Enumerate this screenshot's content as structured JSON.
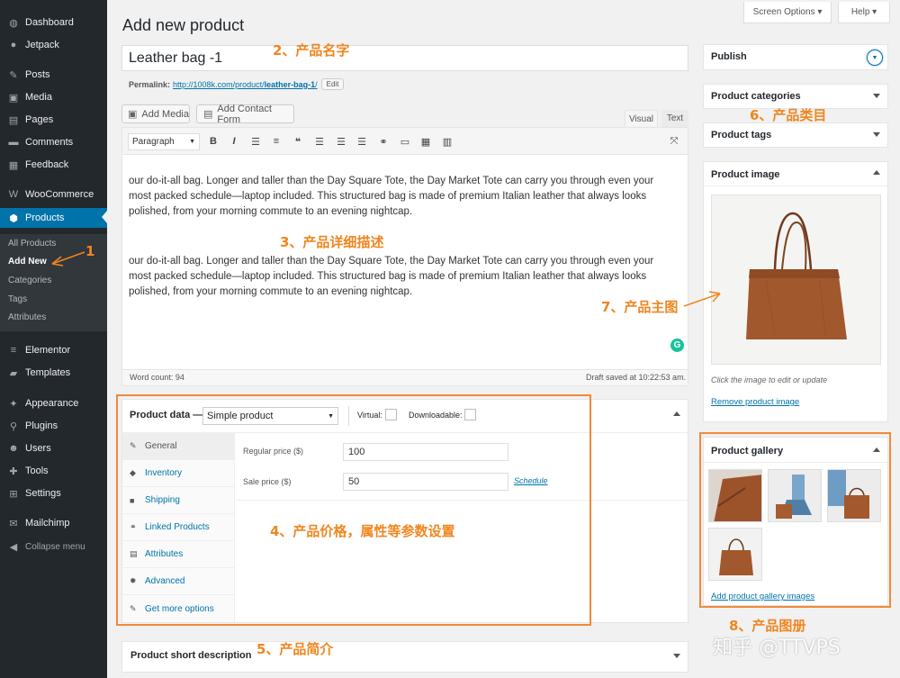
{
  "sidebar": {
    "items": [
      {
        "label": "Dashboard",
        "icon": "dashboard-icon",
        "glyph": "◍"
      },
      {
        "label": "Jetpack",
        "icon": "jetpack-icon",
        "glyph": "●"
      },
      {
        "label": "Posts",
        "icon": "pushpin-icon",
        "glyph": "✎"
      },
      {
        "label": "Media",
        "icon": "media-icon",
        "glyph": "▣"
      },
      {
        "label": "Pages",
        "icon": "pages-icon",
        "glyph": "▤"
      },
      {
        "label": "Comments",
        "icon": "comment-icon",
        "glyph": "▬"
      },
      {
        "label": "Feedback",
        "icon": "feedback-icon",
        "glyph": "▦"
      },
      {
        "label": "WooCommerce",
        "icon": "woocommerce-icon",
        "glyph": "W"
      },
      {
        "label": "Products",
        "icon": "products-icon",
        "glyph": "⬢"
      },
      {
        "label": "Elementor",
        "icon": "elementor-icon",
        "glyph": "≡"
      },
      {
        "label": "Templates",
        "icon": "folder-icon",
        "glyph": "▰"
      },
      {
        "label": "Appearance",
        "icon": "appearance-icon",
        "glyph": "✦"
      },
      {
        "label": "Plugins",
        "icon": "plugin-icon",
        "glyph": "⚲"
      },
      {
        "label": "Users",
        "icon": "users-icon",
        "glyph": "☻"
      },
      {
        "label": "Tools",
        "icon": "tools-icon",
        "glyph": "✚"
      },
      {
        "label": "Settings",
        "icon": "settings-icon",
        "glyph": "⊞"
      },
      {
        "label": "Mailchimp",
        "icon": "mailchimp-icon",
        "glyph": "✉"
      },
      {
        "label": "Collapse menu",
        "icon": "collapse-icon",
        "glyph": "◀"
      }
    ],
    "submenu": [
      "All Products",
      "Add New",
      "Categories",
      "Tags",
      "Attributes"
    ]
  },
  "top": {
    "screen_options": "Screen Options ▾",
    "help": "Help ▾"
  },
  "page_title": "Add new product",
  "title_value": "Leather bag -1",
  "permalink": {
    "label": "Permalink:",
    "url_prefix": "http://1008k.com/product/",
    "url_slug": "leather-bag-1",
    "url_suffix": "/",
    "edit": "Edit"
  },
  "editor": {
    "add_media": "Add Media",
    "add_contact_form": "Add Contact Form",
    "tab_visual": "Visual",
    "tab_text": "Text",
    "format": "Paragraph",
    "paragraph1": "our do-it-all bag. Longer and taller than the Day Square Tote, the Day Market Tote can carry you through even your most packed schedule—laptop included. This structured bag is made of premium Italian leather that always looks polished, from your morning commute to an evening nightcap.",
    "paragraph2": "our do-it-all bag. Longer and taller than the Day Square Tote, the Day Market Tote can carry you through even your most packed schedule—laptop included. This structured bag is made of premium Italian leather that always looks polished, from your morning commute to an evening nightcap.",
    "word_count": "Word count: 94",
    "draft_saved": "Draft saved at 10:22:53 am."
  },
  "product_data": {
    "label": "Product data —",
    "type": "Simple product",
    "virtual": "Virtual:",
    "downloadable": "Downloadable:",
    "tabs": [
      "General",
      "Inventory",
      "Shipping",
      "Linked Products",
      "Attributes",
      "Advanced",
      "Get more options"
    ],
    "regular_price_label": "Regular price ($)",
    "regular_price": "100",
    "sale_price_label": "Sale price ($)",
    "sale_price": "50",
    "schedule": "Schedule"
  },
  "short_description": "Product short description",
  "right": {
    "publish": "Publish",
    "categories": "Product categories",
    "tags": "Product tags",
    "image": "Product image",
    "image_hint": "Click the image to edit or update",
    "remove_image": "Remove product image",
    "gallery": "Product gallery",
    "add_gallery": "Add product gallery images"
  },
  "annotations": {
    "a1": "1",
    "a2": "2、产品名字",
    "a3": "3、产品详细描述",
    "a4": "4、产品价格，属性等参数设置",
    "a5": "5、产品简介",
    "a6": "6、产品类目",
    "a7": "7、产品主图",
    "a8": "8、产品图册"
  },
  "watermark": "知乎 @TTVPS",
  "colors": {
    "sidebar": "#23282d",
    "accent": "#0073aa",
    "annotation": "#f0861f",
    "leather": "#a0552b"
  }
}
